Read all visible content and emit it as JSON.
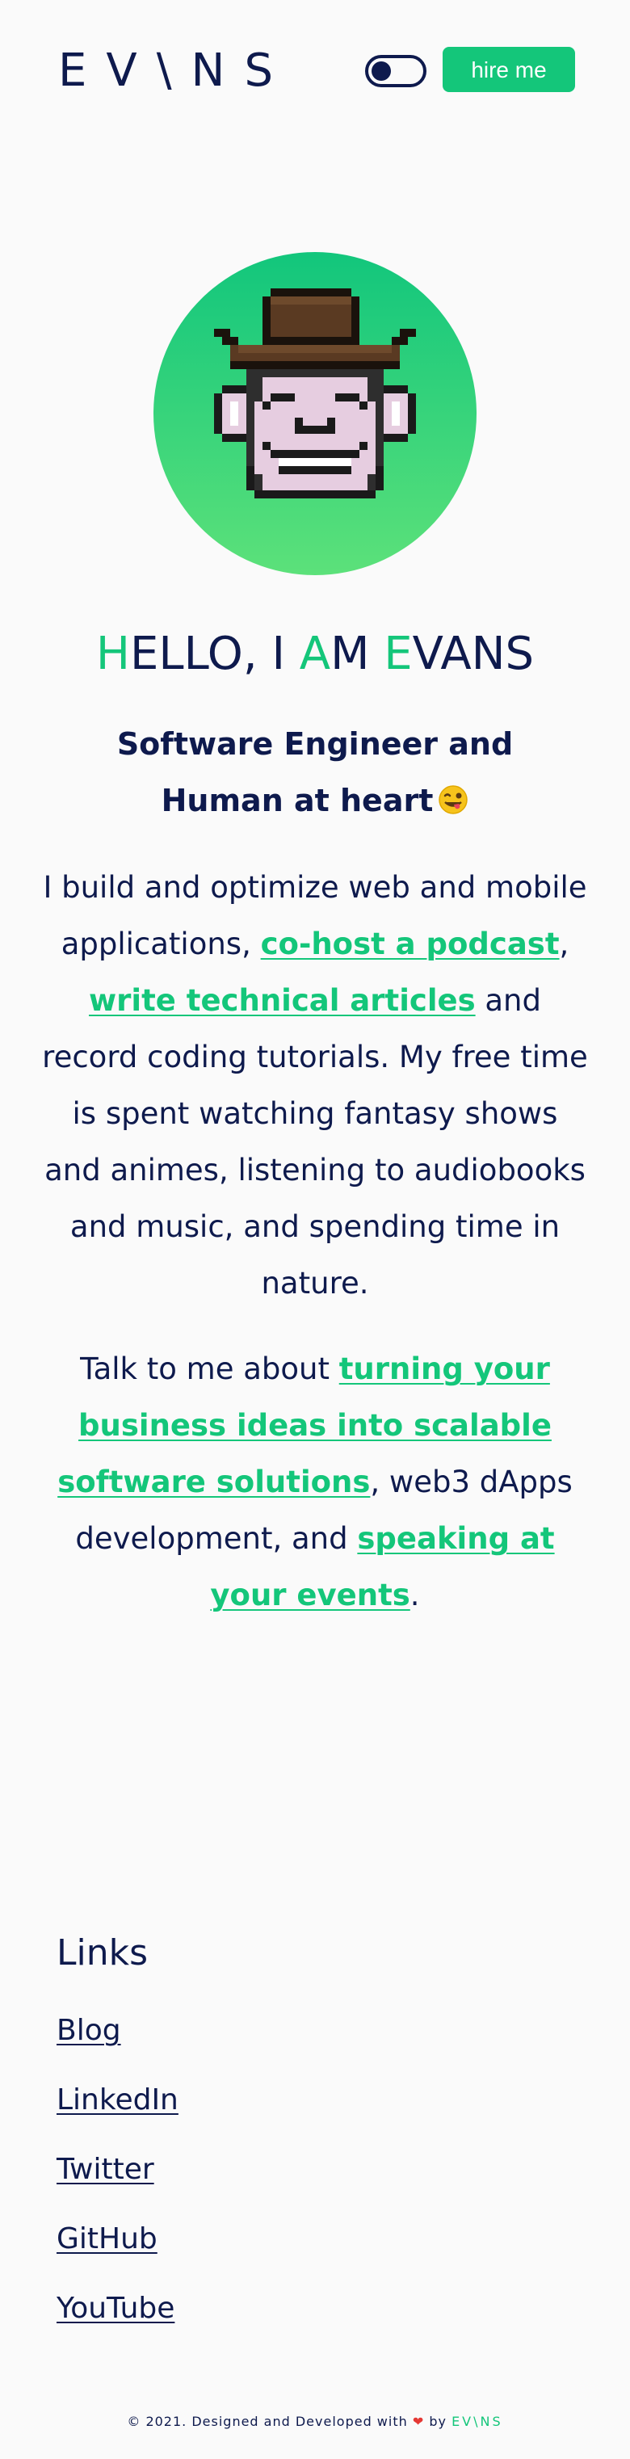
{
  "header": {
    "logo": "EV\\NS",
    "hire_label": "hire me"
  },
  "hero": {
    "hello_h": "H",
    "hello_rest1": "ELLO, I ",
    "hello_a": "A",
    "hello_rest2": "M ",
    "hello_e": "E",
    "hello_rest3": "VANS",
    "subtitle": "Software Engineer and Human at heart",
    "p1_a": "I build and optimize web and mobile applications, ",
    "p1_link1": "co-host a podcast",
    "p1_b": ", ",
    "p1_link2": "write technical articles",
    "p1_c": " and record coding tutorials. My free time is spent watching fantasy shows and animes, listening to audiobooks and music, and spending time in nature.",
    "p2_a": "Talk to me about ",
    "p2_link1": "turning your business ideas into scalable software solutions",
    "p2_b": ", web3 dApps development, and ",
    "p2_link2": "speaking at your events",
    "p2_c": "."
  },
  "links": {
    "title": "Links",
    "items": [
      "Blog",
      "LinkedIn",
      "Twitter",
      "GitHub",
      "YouTube"
    ]
  },
  "footer": {
    "text": "© 2021. Designed and Developed with",
    "heart": "❤",
    "by": "by",
    "brand": "EV\\NS"
  },
  "colors": {
    "accent": "#14c67a",
    "navy": "#0e1a4d",
    "background": "#fafafa"
  },
  "icons": {
    "theme_toggle": "toggle-switch",
    "avatar": "pixel-monkey-cowboy-hat",
    "wink": "winking-face-tongue-emoji",
    "heart": "heart-icon"
  }
}
